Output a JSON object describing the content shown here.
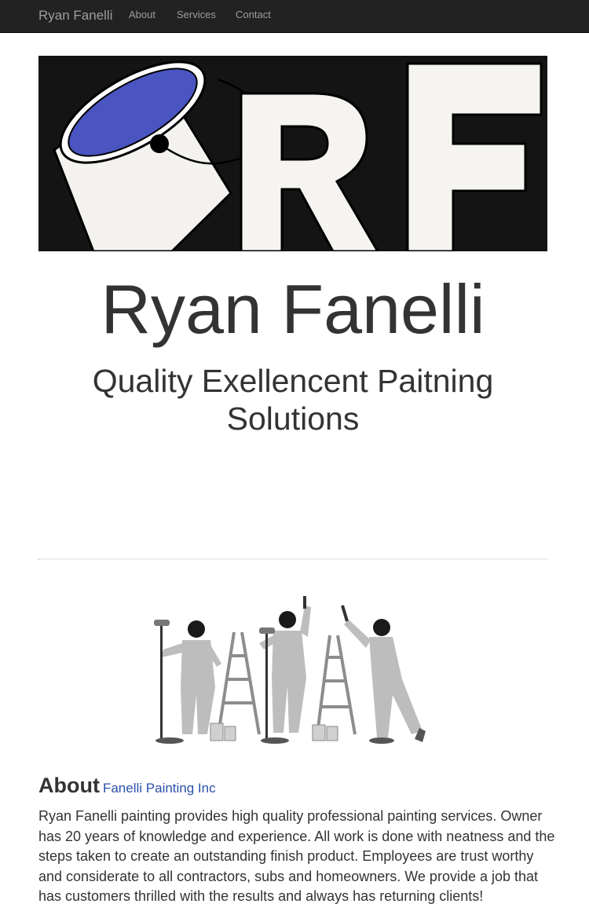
{
  "navbar": {
    "brand": "Ryan Fanelli",
    "links": [
      "About",
      "Services",
      "Contact"
    ]
  },
  "hero": {
    "logo_letters": "RF",
    "colors": {
      "background": "#141414",
      "letters": "#ffffff",
      "paint": "#4a55c2"
    }
  },
  "header": {
    "title": "Ryan Fanelli",
    "subtitle": "Quality Exellencent Paitning Solutions"
  },
  "about": {
    "heading": "About",
    "subheading": "Fanelli Painting Inc",
    "text": "Ryan Fanelli painting provides high quality professional painting services. Owner has 20 years of knowledge and experience. All work is done with neatness and the steps taken to create an outstanding finish product. Employees are trust worthy and considerate to all contractors, subs and homeowners. We provide a job that has customers thrilled with the results and always has returning clients!"
  }
}
